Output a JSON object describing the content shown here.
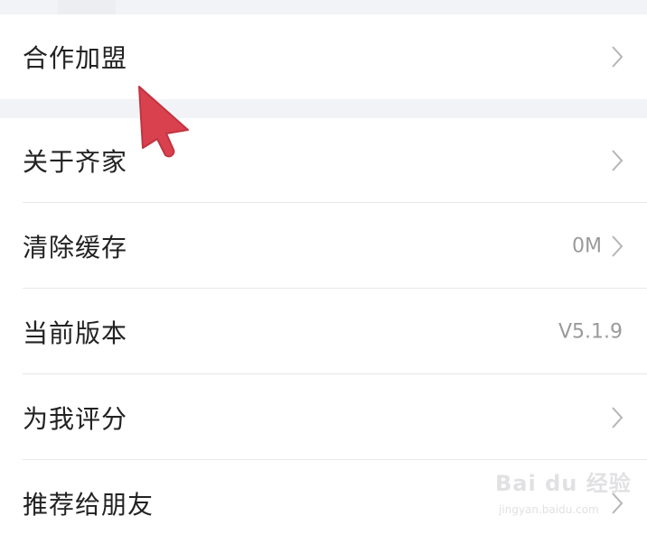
{
  "settings": {
    "group1": [
      {
        "label": "合作加盟",
        "value": "",
        "chevron": true
      }
    ],
    "group2": [
      {
        "label": "关于齐家",
        "value": "",
        "chevron": true
      },
      {
        "label": "清除缓存",
        "value": "0M",
        "chevron": true
      },
      {
        "label": "当前版本",
        "value": "V5.1.9",
        "chevron": false
      },
      {
        "label": "为我评分",
        "value": "",
        "chevron": true
      },
      {
        "label": "推荐给朋友",
        "value": "",
        "chevron": true
      }
    ]
  },
  "watermark": {
    "brand": "Bai du 经验",
    "url": "jingyan.baidu.com"
  },
  "colors": {
    "cursor": "#d9414f",
    "background": "#f2f3f6",
    "text": "#222222",
    "secondary_text": "#9a9a9a"
  },
  "icons": {
    "chevron": "chevron-right-icon",
    "pointer": "arrow-cursor-icon"
  }
}
